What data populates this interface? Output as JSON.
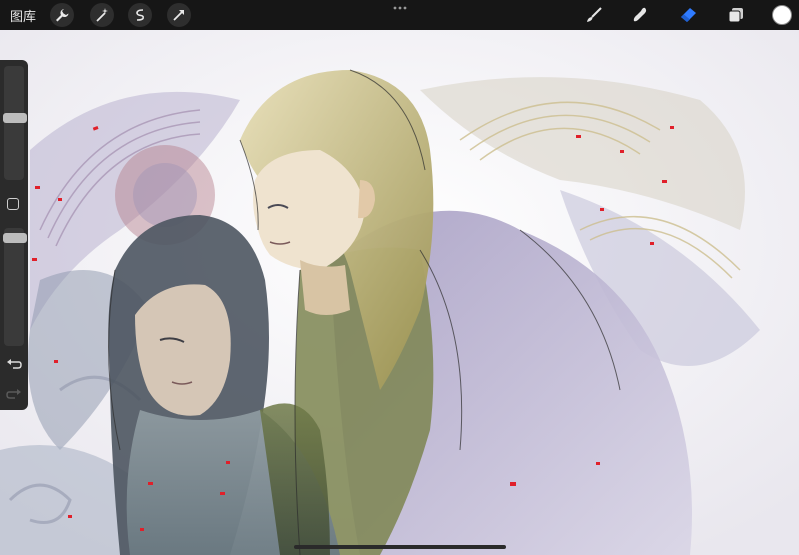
{
  "toolbar": {
    "gallery_label": "图库",
    "left_tools": [
      "wrench-icon",
      "magic-wand-icon",
      "selection-s-icon",
      "transform-arrow-icon"
    ],
    "right_tools": [
      "brush-icon",
      "smudge-icon",
      "eraser-icon",
      "layers-icon"
    ],
    "active_tool": "eraser-icon",
    "active_color": "#ffffff",
    "accent_color": "#2f7bff"
  },
  "sidebar": {
    "size_level": 0.55,
    "opacity_level": 0.95,
    "modify_button_icon": "square-icon",
    "undo_icon": "undo-arrow-icon",
    "redo_icon": "redo-arrow-icon"
  }
}
